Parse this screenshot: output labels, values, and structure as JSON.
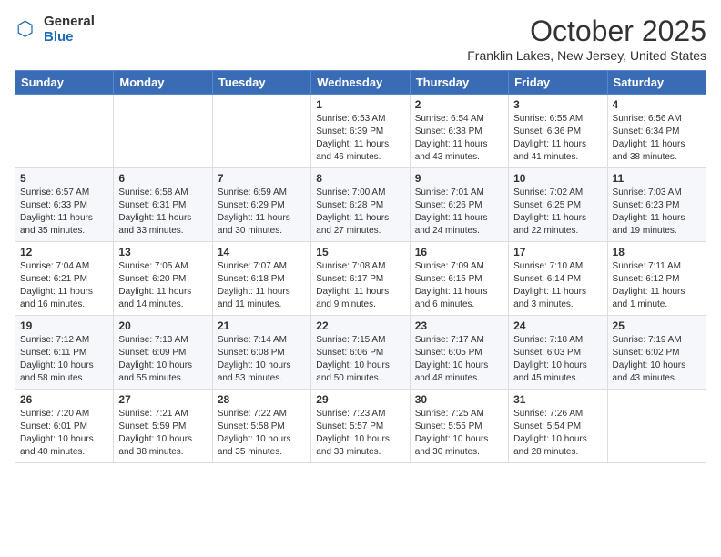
{
  "logo": {
    "general": "General",
    "blue": "Blue"
  },
  "title": "October 2025",
  "location": "Franklin Lakes, New Jersey, United States",
  "weekdays": [
    "Sunday",
    "Monday",
    "Tuesday",
    "Wednesday",
    "Thursday",
    "Friday",
    "Saturday"
  ],
  "weeks": [
    [
      {
        "day": "",
        "content": ""
      },
      {
        "day": "",
        "content": ""
      },
      {
        "day": "",
        "content": ""
      },
      {
        "day": "1",
        "content": "Sunrise: 6:53 AM\nSunset: 6:39 PM\nDaylight: 11 hours\nand 46 minutes."
      },
      {
        "day": "2",
        "content": "Sunrise: 6:54 AM\nSunset: 6:38 PM\nDaylight: 11 hours\nand 43 minutes."
      },
      {
        "day": "3",
        "content": "Sunrise: 6:55 AM\nSunset: 6:36 PM\nDaylight: 11 hours\nand 41 minutes."
      },
      {
        "day": "4",
        "content": "Sunrise: 6:56 AM\nSunset: 6:34 PM\nDaylight: 11 hours\nand 38 minutes."
      }
    ],
    [
      {
        "day": "5",
        "content": "Sunrise: 6:57 AM\nSunset: 6:33 PM\nDaylight: 11 hours\nand 35 minutes."
      },
      {
        "day": "6",
        "content": "Sunrise: 6:58 AM\nSunset: 6:31 PM\nDaylight: 11 hours\nand 33 minutes."
      },
      {
        "day": "7",
        "content": "Sunrise: 6:59 AM\nSunset: 6:29 PM\nDaylight: 11 hours\nand 30 minutes."
      },
      {
        "day": "8",
        "content": "Sunrise: 7:00 AM\nSunset: 6:28 PM\nDaylight: 11 hours\nand 27 minutes."
      },
      {
        "day": "9",
        "content": "Sunrise: 7:01 AM\nSunset: 6:26 PM\nDaylight: 11 hours\nand 24 minutes."
      },
      {
        "day": "10",
        "content": "Sunrise: 7:02 AM\nSunset: 6:25 PM\nDaylight: 11 hours\nand 22 minutes."
      },
      {
        "day": "11",
        "content": "Sunrise: 7:03 AM\nSunset: 6:23 PM\nDaylight: 11 hours\nand 19 minutes."
      }
    ],
    [
      {
        "day": "12",
        "content": "Sunrise: 7:04 AM\nSunset: 6:21 PM\nDaylight: 11 hours\nand 16 minutes."
      },
      {
        "day": "13",
        "content": "Sunrise: 7:05 AM\nSunset: 6:20 PM\nDaylight: 11 hours\nand 14 minutes."
      },
      {
        "day": "14",
        "content": "Sunrise: 7:07 AM\nSunset: 6:18 PM\nDaylight: 11 hours\nand 11 minutes."
      },
      {
        "day": "15",
        "content": "Sunrise: 7:08 AM\nSunset: 6:17 PM\nDaylight: 11 hours\nand 9 minutes."
      },
      {
        "day": "16",
        "content": "Sunrise: 7:09 AM\nSunset: 6:15 PM\nDaylight: 11 hours\nand 6 minutes."
      },
      {
        "day": "17",
        "content": "Sunrise: 7:10 AM\nSunset: 6:14 PM\nDaylight: 11 hours\nand 3 minutes."
      },
      {
        "day": "18",
        "content": "Sunrise: 7:11 AM\nSunset: 6:12 PM\nDaylight: 11 hours\nand 1 minute."
      }
    ],
    [
      {
        "day": "19",
        "content": "Sunrise: 7:12 AM\nSunset: 6:11 PM\nDaylight: 10 hours\nand 58 minutes."
      },
      {
        "day": "20",
        "content": "Sunrise: 7:13 AM\nSunset: 6:09 PM\nDaylight: 10 hours\nand 55 minutes."
      },
      {
        "day": "21",
        "content": "Sunrise: 7:14 AM\nSunset: 6:08 PM\nDaylight: 10 hours\nand 53 minutes."
      },
      {
        "day": "22",
        "content": "Sunrise: 7:15 AM\nSunset: 6:06 PM\nDaylight: 10 hours\nand 50 minutes."
      },
      {
        "day": "23",
        "content": "Sunrise: 7:17 AM\nSunset: 6:05 PM\nDaylight: 10 hours\nand 48 minutes."
      },
      {
        "day": "24",
        "content": "Sunrise: 7:18 AM\nSunset: 6:03 PM\nDaylight: 10 hours\nand 45 minutes."
      },
      {
        "day": "25",
        "content": "Sunrise: 7:19 AM\nSunset: 6:02 PM\nDaylight: 10 hours\nand 43 minutes."
      }
    ],
    [
      {
        "day": "26",
        "content": "Sunrise: 7:20 AM\nSunset: 6:01 PM\nDaylight: 10 hours\nand 40 minutes."
      },
      {
        "day": "27",
        "content": "Sunrise: 7:21 AM\nSunset: 5:59 PM\nDaylight: 10 hours\nand 38 minutes."
      },
      {
        "day": "28",
        "content": "Sunrise: 7:22 AM\nSunset: 5:58 PM\nDaylight: 10 hours\nand 35 minutes."
      },
      {
        "day": "29",
        "content": "Sunrise: 7:23 AM\nSunset: 5:57 PM\nDaylight: 10 hours\nand 33 minutes."
      },
      {
        "day": "30",
        "content": "Sunrise: 7:25 AM\nSunset: 5:55 PM\nDaylight: 10 hours\nand 30 minutes."
      },
      {
        "day": "31",
        "content": "Sunrise: 7:26 AM\nSunset: 5:54 PM\nDaylight: 10 hours\nand 28 minutes."
      },
      {
        "day": "",
        "content": ""
      }
    ]
  ]
}
